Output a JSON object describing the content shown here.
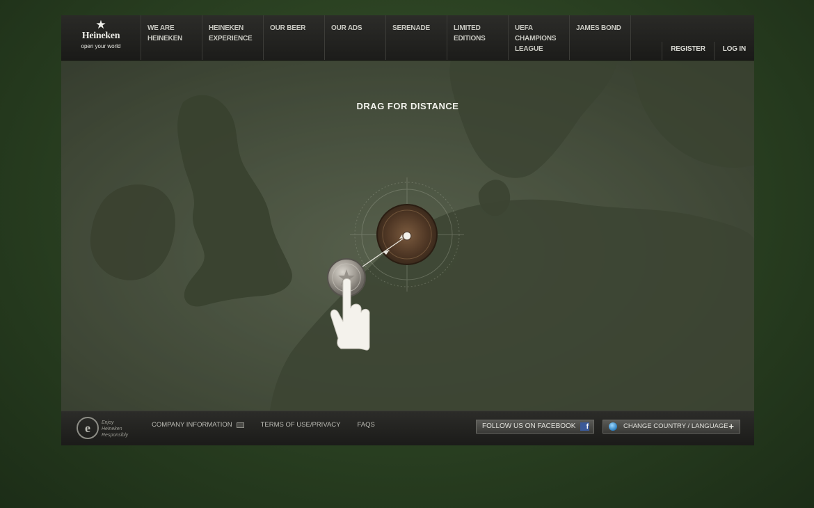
{
  "logo": {
    "brand": "Heineken",
    "tagline": "open your world"
  },
  "nav": {
    "items": [
      {
        "label": "WE ARE\nHEINEKEN"
      },
      {
        "label": "HEINEKEN\nEXPERIENCE"
      },
      {
        "label": "OUR BEER"
      },
      {
        "label": "OUR ADS"
      },
      {
        "label": "SERENADE"
      },
      {
        "label": "LIMITED\nEDITIONS"
      },
      {
        "label": "UEFA\nCHAMPIONS\nLEAGUE"
      },
      {
        "label": "JAMES BOND"
      }
    ],
    "register": "REGISTER",
    "login": "LOG IN"
  },
  "map": {
    "instruction": "DRAG FOR DISTANCE"
  },
  "footer": {
    "enjoy_text": "Enjoy\nHeineken\nResponsibly",
    "company_info": "COMPANY INFORMATION",
    "terms": "TERMS OF USE/PRIVACY",
    "faqs": "FAQS",
    "facebook": "FOLLOW US ON FACEBOOK",
    "country": "CHANGE COUNTRY / LANGUAGE"
  },
  "colors": {
    "background": "#2c4323",
    "map": "#4a5340",
    "facebook": "#3b5998"
  }
}
